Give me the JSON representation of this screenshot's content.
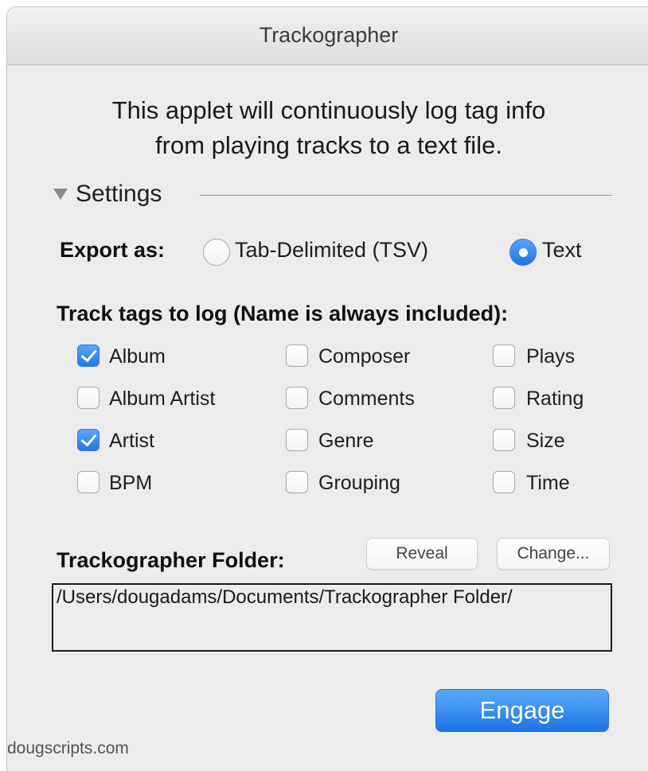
{
  "window": {
    "title": "Trackographer"
  },
  "description": "This applet will continuously log tag info\nfrom playing tracks to a text file.",
  "settings": {
    "label": "Settings",
    "disclosure_icon": "disclosure-triangle-down-icon",
    "export_as": {
      "label": "Export as:",
      "options": [
        {
          "label": "Tab-Delimited (TSV)",
          "selected": false
        },
        {
          "label": "Text",
          "selected": true
        }
      ]
    },
    "tags_heading": "Track tags to log (Name is always included):",
    "tags": [
      {
        "label": "Album",
        "checked": true
      },
      {
        "label": "Album Artist",
        "checked": false
      },
      {
        "label": "Artist",
        "checked": true
      },
      {
        "label": "BPM",
        "checked": false
      },
      {
        "label": "Composer",
        "checked": false
      },
      {
        "label": "Comments",
        "checked": false
      },
      {
        "label": "Genre",
        "checked": false
      },
      {
        "label": "Grouping",
        "checked": false
      },
      {
        "label": "Plays",
        "checked": false
      },
      {
        "label": "Rating",
        "checked": false
      },
      {
        "label": "Size",
        "checked": false
      },
      {
        "label": "Time",
        "checked": false
      }
    ]
  },
  "folder": {
    "label": "Trackographer Folder:",
    "reveal_label": "Reveal",
    "change_label": "Change...",
    "path": "/Users/dougadams/Documents/Trackographer Folder/"
  },
  "engage_label": "Engage",
  "footer": "dougscripts.com",
  "colors": {
    "accent": "#2179e8",
    "window_bg": "#ececec"
  }
}
